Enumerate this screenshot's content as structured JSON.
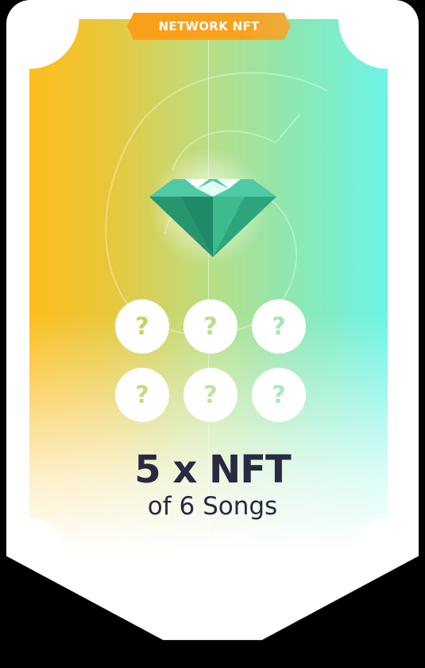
{
  "badge": {
    "label": "NETWORK NFT"
  },
  "slots": [
    {
      "label": "?",
      "color": "#c9d35a"
    },
    {
      "label": "?",
      "color": "#b6df8a"
    },
    {
      "label": "?",
      "color": "#a6e6b4"
    },
    {
      "label": "?",
      "color": "#cfd87c"
    },
    {
      "label": "?",
      "color": "#bde4a0"
    },
    {
      "label": "?",
      "color": "#a8e8c0"
    }
  ],
  "title": "5 x NFT",
  "subtitle": "of 6 Songs",
  "colors": {
    "gradient_start": "#fcbd1d",
    "gradient_end": "#6cf4e6",
    "badge": "#fb9f1a",
    "text": "#272a40",
    "gem": "#2fa57e"
  }
}
